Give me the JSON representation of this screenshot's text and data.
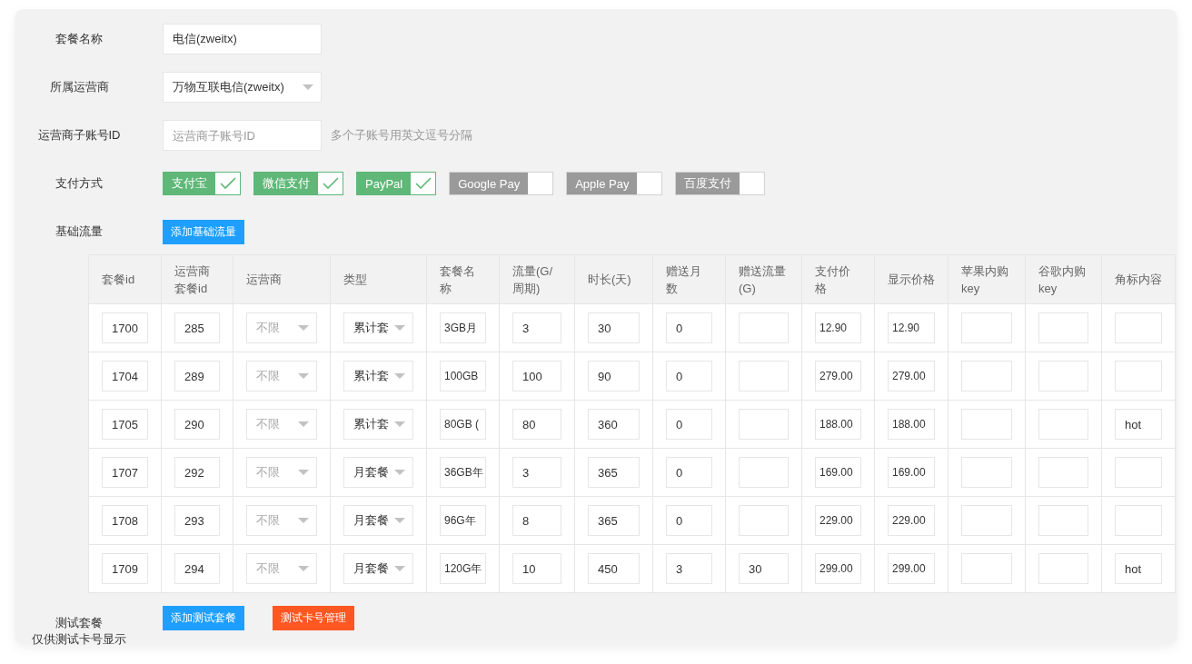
{
  "form": {
    "package_name": {
      "label": "套餐名称",
      "value": "电信(zweitx)"
    },
    "carrier": {
      "label": "所属运营商",
      "value": "万物互联电信(zweitx)"
    },
    "sub_account": {
      "label": "运营商子账号ID",
      "placeholder": "运营商子账号ID",
      "hint": "多个子账号用英文逗号分隔"
    },
    "payment": {
      "label": "支付方式",
      "options": [
        {
          "label": "支付宝",
          "checked": true
        },
        {
          "label": "微信支付",
          "checked": true
        },
        {
          "label": "PayPal",
          "checked": true
        },
        {
          "label": "Google Pay",
          "checked": false
        },
        {
          "label": "Apple Pay",
          "checked": false
        },
        {
          "label": "百度支付",
          "checked": false
        }
      ]
    },
    "base_traffic": {
      "label": "基础流量",
      "add_button": "添加基础流量"
    }
  },
  "table": {
    "columns": [
      "套餐id",
      "运营商套餐id",
      "运营商",
      "类型",
      "套餐名称",
      "流量(G/周期)",
      "时长(天)",
      "赠送月数",
      "赠送流量(G)",
      "支付价格",
      "显示价格",
      "苹果内购key",
      "谷歌内购key",
      "角标内容"
    ],
    "rows": [
      {
        "cells": [
          {
            "kind": "input",
            "value": "1700"
          },
          {
            "kind": "input",
            "value": "285"
          },
          {
            "kind": "select",
            "value": "不限",
            "disabled": true
          },
          {
            "kind": "select",
            "value": "累计套",
            "disabled": false
          },
          {
            "kind": "input",
            "value": "3GB月"
          },
          {
            "kind": "input",
            "value": "3"
          },
          {
            "kind": "input",
            "value": "30"
          },
          {
            "kind": "input",
            "value": "0"
          },
          {
            "kind": "input"
          },
          {
            "kind": "input",
            "value": "12.90"
          },
          {
            "kind": "input",
            "value": "12.90"
          },
          {
            "kind": "input"
          },
          {
            "kind": "input"
          },
          {
            "kind": "input"
          }
        ]
      },
      {
        "cells": [
          {
            "kind": "input",
            "value": "1704"
          },
          {
            "kind": "input",
            "value": "289"
          },
          {
            "kind": "select",
            "value": "不限",
            "disabled": true
          },
          {
            "kind": "select",
            "value": "累计套",
            "disabled": false
          },
          {
            "kind": "input",
            "value": "100GB"
          },
          {
            "kind": "input",
            "value": "100"
          },
          {
            "kind": "input",
            "value": "90"
          },
          {
            "kind": "input",
            "value": "0"
          },
          {
            "kind": "input"
          },
          {
            "kind": "input",
            "value": "279.00"
          },
          {
            "kind": "input",
            "value": "279.00"
          },
          {
            "kind": "input"
          },
          {
            "kind": "input"
          },
          {
            "kind": "input"
          }
        ]
      },
      {
        "cells": [
          {
            "kind": "input",
            "value": "1705"
          },
          {
            "kind": "input",
            "value": "290"
          },
          {
            "kind": "select",
            "value": "不限",
            "disabled": true
          },
          {
            "kind": "select",
            "value": "累计套",
            "disabled": false
          },
          {
            "kind": "input",
            "value": "80GB ("
          },
          {
            "kind": "input",
            "value": "80"
          },
          {
            "kind": "input",
            "value": "360"
          },
          {
            "kind": "input",
            "value": "0"
          },
          {
            "kind": "input"
          },
          {
            "kind": "input",
            "value": "188.00"
          },
          {
            "kind": "input",
            "value": "188.00"
          },
          {
            "kind": "input"
          },
          {
            "kind": "input"
          },
          {
            "kind": "input",
            "value": "hot"
          }
        ]
      },
      {
        "cells": [
          {
            "kind": "input",
            "value": "1707"
          },
          {
            "kind": "input",
            "value": "292"
          },
          {
            "kind": "select",
            "value": "不限",
            "disabled": true
          },
          {
            "kind": "select",
            "value": "月套餐",
            "disabled": false
          },
          {
            "kind": "input",
            "value": "36GB年"
          },
          {
            "kind": "input",
            "value": "3"
          },
          {
            "kind": "input",
            "value": "365"
          },
          {
            "kind": "input",
            "value": "0"
          },
          {
            "kind": "input"
          },
          {
            "kind": "input",
            "value": "169.00"
          },
          {
            "kind": "input",
            "value": "169.00"
          },
          {
            "kind": "input"
          },
          {
            "kind": "input"
          },
          {
            "kind": "input"
          }
        ]
      },
      {
        "cells": [
          {
            "kind": "input",
            "value": "1708"
          },
          {
            "kind": "input",
            "value": "293"
          },
          {
            "kind": "select",
            "value": "不限",
            "disabled": true
          },
          {
            "kind": "select",
            "value": "月套餐",
            "disabled": false
          },
          {
            "kind": "input",
            "value": "96G年"
          },
          {
            "kind": "input",
            "value": "8"
          },
          {
            "kind": "input",
            "value": "365"
          },
          {
            "kind": "input",
            "value": "0"
          },
          {
            "kind": "input"
          },
          {
            "kind": "input",
            "value": "229.00"
          },
          {
            "kind": "input",
            "value": "229.00"
          },
          {
            "kind": "input"
          },
          {
            "kind": "input"
          },
          {
            "kind": "input"
          }
        ]
      },
      {
        "cells": [
          {
            "kind": "input",
            "value": "1709"
          },
          {
            "kind": "input",
            "value": "294"
          },
          {
            "kind": "select",
            "value": "不限",
            "disabled": true
          },
          {
            "kind": "select",
            "value": "月套餐",
            "disabled": false
          },
          {
            "kind": "input",
            "value": "120G年"
          },
          {
            "kind": "input",
            "value": "10"
          },
          {
            "kind": "input",
            "value": "450"
          },
          {
            "kind": "input",
            "value": "3"
          },
          {
            "kind": "input",
            "value": "30"
          },
          {
            "kind": "input",
            "value": "299.00"
          },
          {
            "kind": "input",
            "value": "299.00"
          },
          {
            "kind": "input"
          },
          {
            "kind": "input"
          },
          {
            "kind": "input",
            "value": "hot"
          }
        ]
      }
    ]
  },
  "test_package": {
    "label_lines": [
      "测试套餐",
      "仅供测试卡号显示"
    ],
    "add_button": "添加测试套餐",
    "manage_button": "测试卡号管理"
  }
}
